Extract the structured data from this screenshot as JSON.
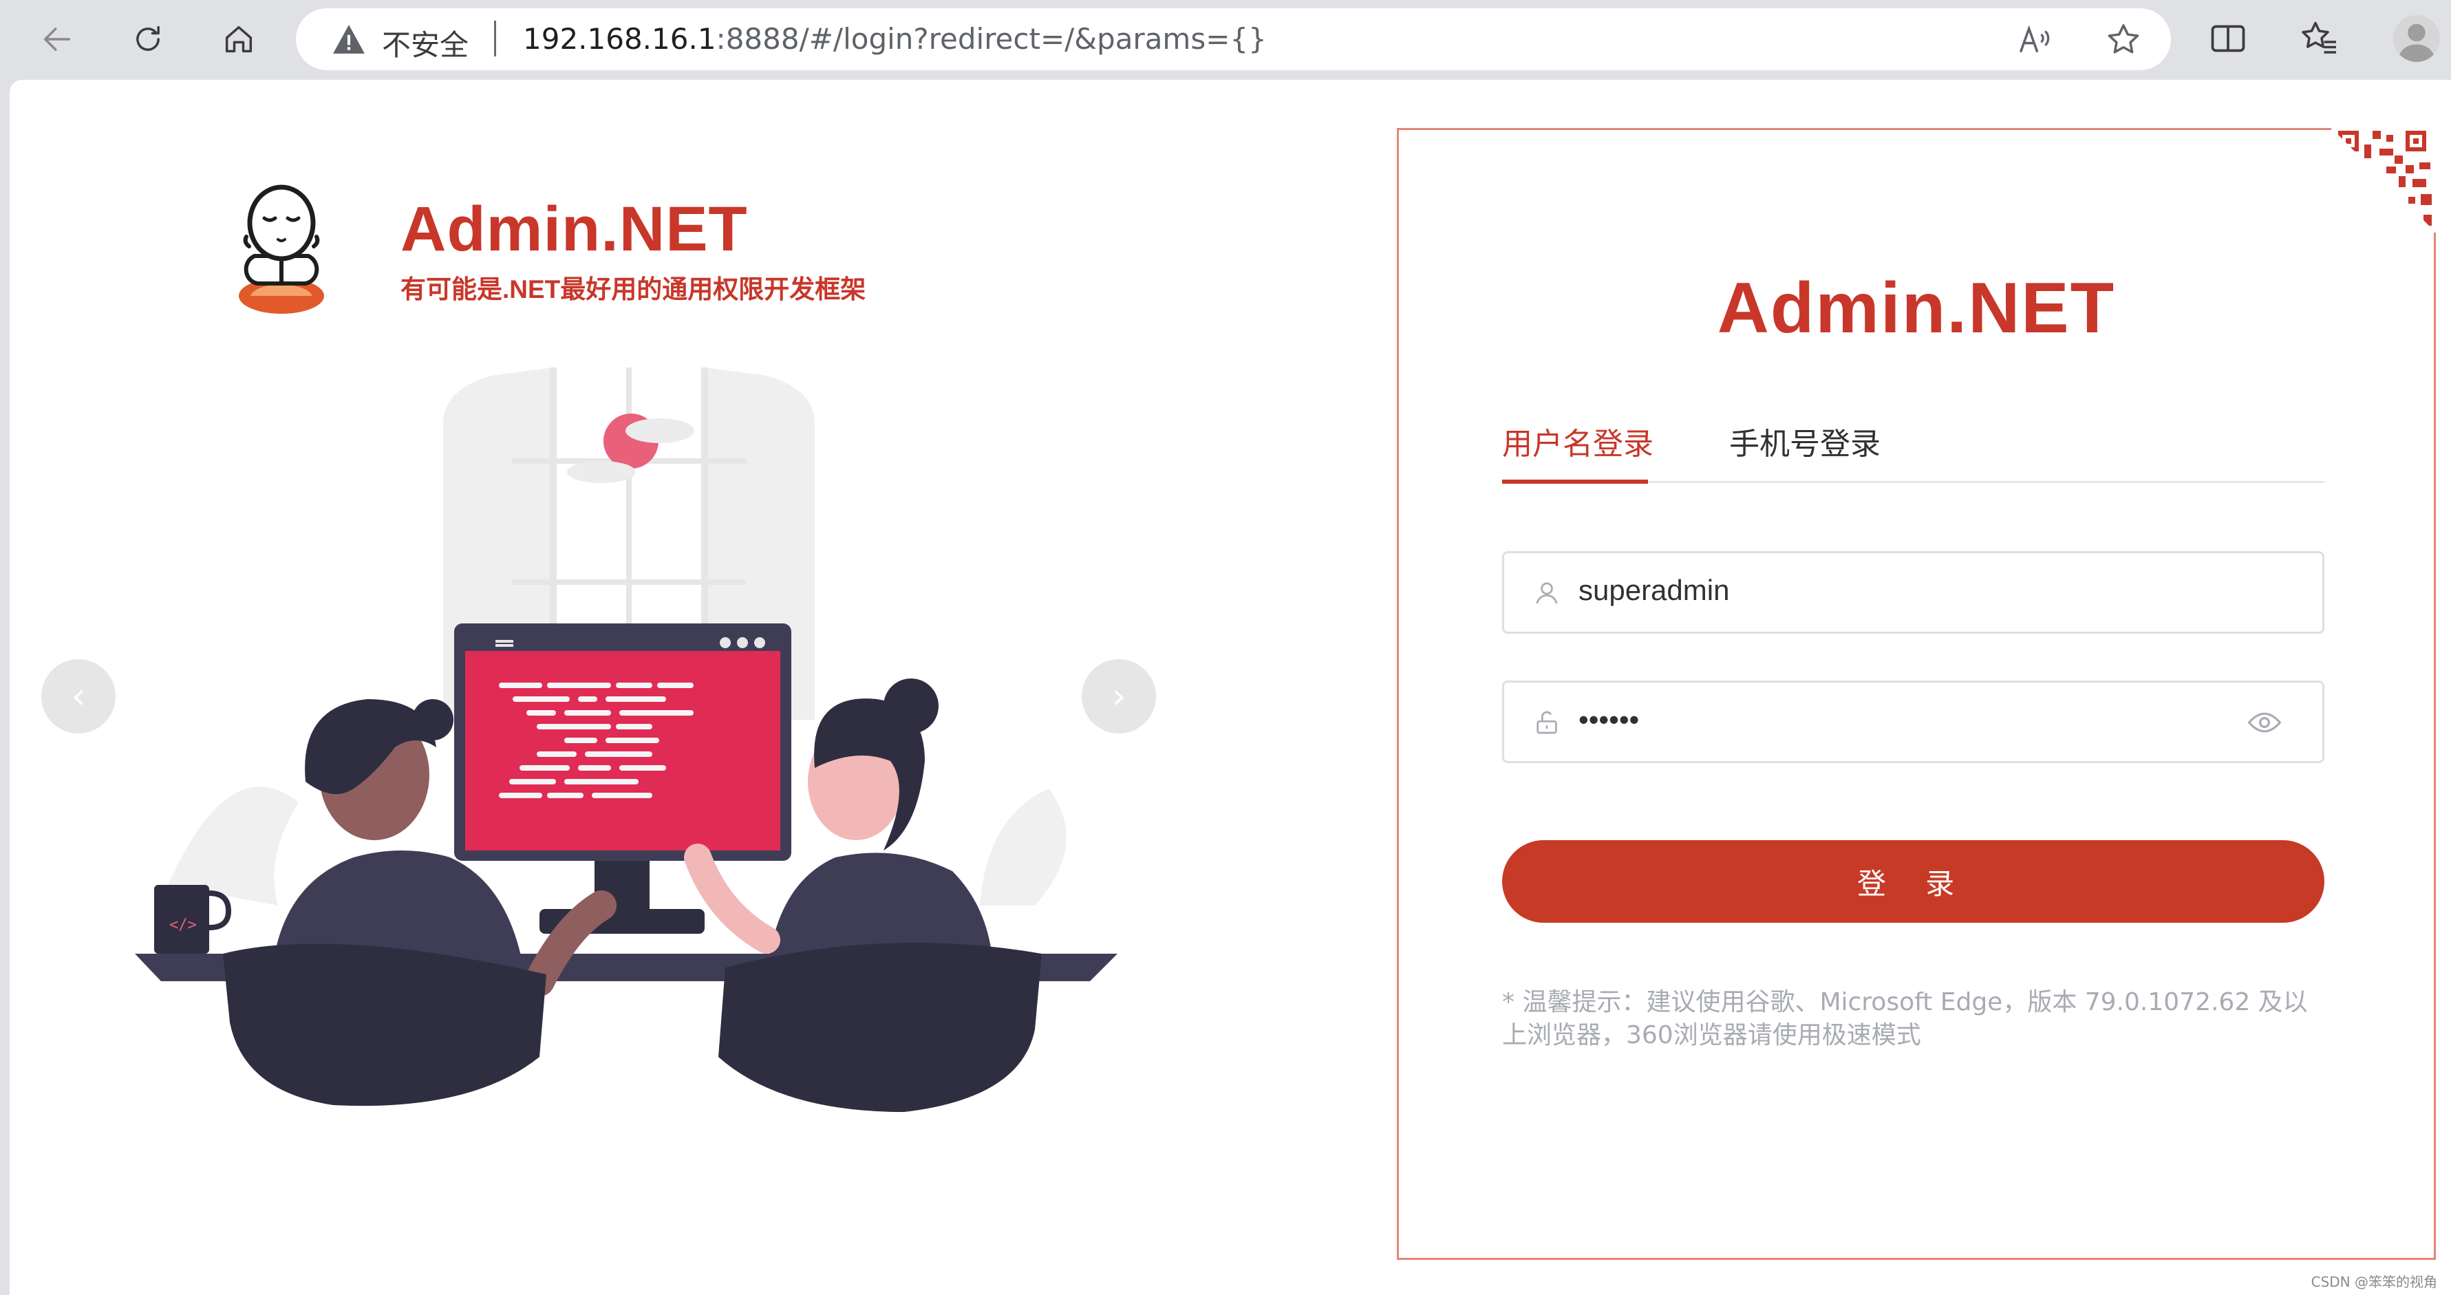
{
  "browser": {
    "security_label": "不安全",
    "url_host": "192.168.16.1",
    "url_rest": ":8888/#/login?redirect=/&params={}"
  },
  "brand": {
    "title": "Admin.NET",
    "subtitle": "有可能是.NET最好用的通用权限开发框架"
  },
  "carousel": {
    "prev_label": "‹",
    "next_label": "›"
  },
  "login": {
    "title": "Admin.NET",
    "tabs": [
      {
        "label": "用户名登录",
        "active": true
      },
      {
        "label": "手机号登录",
        "active": false
      }
    ],
    "username": "superadmin",
    "password_mask": "••••••",
    "submit_label": "登 录",
    "tip": "* 温馨提示：建议使用谷歌、Microsoft Edge，版本 79.0.1072.62 及以上浏览器，360浏览器请使用极速模式"
  },
  "watermark": "CSDN @笨笨的视角",
  "colors": {
    "brand_red": "#c8372a",
    "button_red": "#c73a26",
    "chrome_gray": "#dfe1e5"
  }
}
